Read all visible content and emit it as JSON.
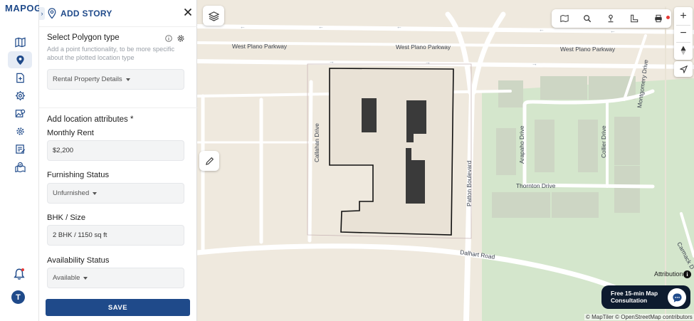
{
  "app": {
    "logo": "MAPOG"
  },
  "rail": {
    "items": [
      {
        "icon": "map-icon",
        "active": false
      },
      {
        "icon": "location-pin-icon",
        "active": true
      },
      {
        "icon": "add-file-icon",
        "active": false
      },
      {
        "icon": "settings-icon",
        "active": false
      },
      {
        "icon": "gallery-icon",
        "active": false
      },
      {
        "icon": "gear-cog-icon",
        "active": false
      },
      {
        "icon": "edit-note-icon",
        "active": false
      },
      {
        "icon": "map-check-icon",
        "active": false
      }
    ],
    "avatar_initial": "T"
  },
  "panel": {
    "title": "ADD STORY",
    "polygon_section": {
      "title": "Select Polygon type",
      "description": "Add a point functionality, to be more specific about the plotted location type",
      "selected": "Rental Property Details"
    },
    "attributes_title": "Add location attributes *",
    "fields": [
      {
        "label": "Monthly Rent",
        "value": "$2,200",
        "type": "input"
      },
      {
        "label": "Furnishing Status",
        "value": "Unfurnished",
        "type": "select"
      },
      {
        "label": "BHK / Size",
        "value": "2 BHK / 1150 sq ft",
        "type": "input"
      },
      {
        "label": "Availability Status",
        "value": "Available",
        "type": "select"
      }
    ],
    "save_label": "SAVE"
  },
  "map": {
    "streets": {
      "parkway_1": "West Plano Parkway",
      "parkway_2": "West Plano Parkway",
      "parkway_3": "West Plano Parkway",
      "callahan": "Callahan Drive",
      "patton": "Patton Boulevard",
      "arapaho": "Arapaho Drive",
      "collier": "Collier Drive",
      "thornton": "Thornton Drive",
      "dalhart": "Dalhart Road",
      "montgomery": "Montgomery Drive",
      "carmack": "Carmack D"
    },
    "attribution": "Attribution",
    "consult": {
      "line1": "Free 15-min Map",
      "line2": "Consultation"
    },
    "copyright": "© MapTiler © OpenStreetMap contributors"
  },
  "colors": {
    "brand": "#1f4a8a",
    "accent": "#f2b600",
    "park": "#d4e6cc",
    "land": "#efe9de"
  }
}
